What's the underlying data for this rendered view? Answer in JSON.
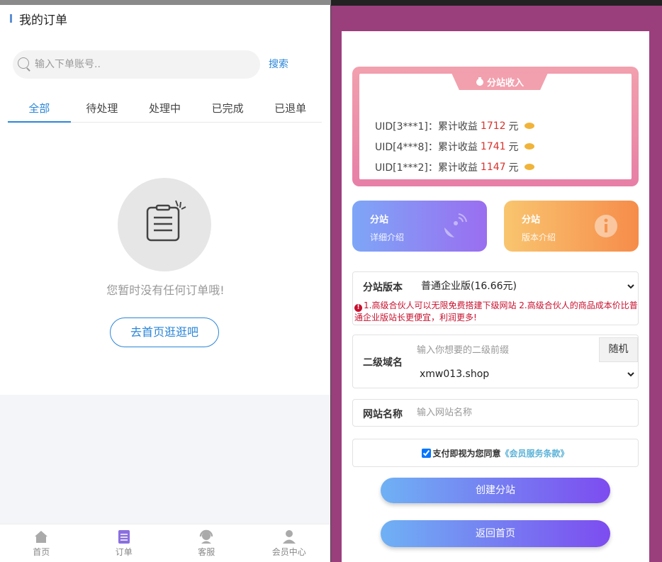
{
  "left": {
    "title": "我的订单",
    "search": {
      "placeholder": "输入下单账号..",
      "button": "搜索"
    },
    "tabs": [
      "全部",
      "待处理",
      "处理中",
      "已完成",
      "已退单"
    ],
    "empty_text": "您暂时没有任何订单哦!",
    "go_home": "去首页逛逛吧",
    "nav": [
      {
        "label": "首页",
        "icon": "home-icon"
      },
      {
        "label": "订单",
        "icon": "order-icon"
      },
      {
        "label": "客服",
        "icon": "service-icon"
      },
      {
        "label": "会员中心",
        "icon": "user-icon"
      }
    ]
  },
  "right": {
    "income_title": "分站收入",
    "income_rows": [
      {
        "uid": "UID[3***1]：",
        "label": "累计收益",
        "amount": "1712",
        "unit": "元"
      },
      {
        "uid": "UID[4***8]：",
        "label": "累计收益",
        "amount": "1741",
        "unit": "元"
      },
      {
        "uid": "UID[1***2]：",
        "label": "累计收益",
        "amount": "1147",
        "unit": "元"
      }
    ],
    "card1": {
      "title": "分站",
      "subtitle": "详细介绍"
    },
    "card2": {
      "title": "分站",
      "subtitle": "版本介绍"
    },
    "version": {
      "label": "分站版本",
      "selected": "普通企业版(16.66元)",
      "warning": "1.高级合伙人可以无限免费搭建下级网站 2.高级合伙人的商品成本价比普通企业版站长更便宜，利润更多!"
    },
    "domain": {
      "label": "二级域名",
      "placeholder": "输入你想要的二级前缀",
      "random": "随机",
      "suffix": "xmw013.shop"
    },
    "site_name": {
      "label": "网站名称",
      "placeholder": "输入网站名称"
    },
    "agree": {
      "text": "支付即视为您同意",
      "link": "《会员服务条款》",
      "checked": true
    },
    "create_btn": "创建分站",
    "back_btn": "返回首页"
  },
  "colors": {
    "accent_blue": "#2b86d8",
    "right_bg": "#9a3f7c",
    "amount_red": "#d9322c",
    "warning_red": "#c8102e"
  }
}
